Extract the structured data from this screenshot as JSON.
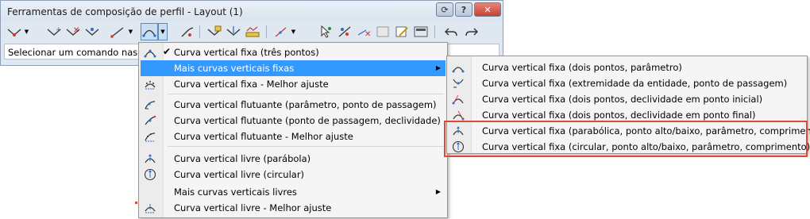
{
  "window": {
    "title": "Ferramentas de composição de perfil - Layout (1)",
    "help_label": "?",
    "close_label": "✕",
    "extra_button_label": "⟳"
  },
  "toolbar": {
    "icons": [
      "pvi-insert-icon",
      "pvi-add-icon",
      "pvi-delete-icon",
      "pvi-move-icon",
      "line-tool-icon",
      "curve-tool-icon",
      "fillet-icon",
      "pvi-table-icon",
      "pvi-raise-icon",
      "pvi-graph-icon",
      "tangent-icon",
      "select-pvi-icon",
      "move-pvi-icon",
      "delete-entity-icon",
      "sub-entity-icon",
      "edit-icon",
      "grid-view-icon",
      "undo-icon",
      "redo-icon"
    ]
  },
  "status": {
    "text": "Selecionar um comando nas fe"
  },
  "menu_main": {
    "items": [
      {
        "label": "Curva vertical fixa (três pontos)",
        "checked": true,
        "icon": "curve-three-points-icon"
      },
      {
        "label": "Mais curvas verticais fixas",
        "highlighted": true,
        "submenu": true
      },
      {
        "label": "Curva vertical fixa - Melhor ajuste",
        "icon": "best-fit-icon"
      },
      {
        "label": "Curva vertical flutuante (parâmetro, ponto de passagem)",
        "icon": "float-param-icon"
      },
      {
        "label": "Curva vertical flutuante (ponto de passagem, declividade)",
        "icon": "float-slope-icon"
      },
      {
        "label": "Curva vertical flutuante - Melhor ajuste",
        "icon": "float-bestfit-icon"
      },
      {
        "label": "Curva vertical livre (parábola)",
        "icon": "free-parabola-icon"
      },
      {
        "label": "Curva vertical livre (circular)",
        "icon": "free-circular-icon"
      },
      {
        "label": "Mais curvas verticais livres",
        "submenu": true
      },
      {
        "label": "Curva vertical livre - Melhor ajuste",
        "icon": "free-bestfit-icon"
      }
    ]
  },
  "menu_sub": {
    "items": [
      {
        "label": "Curva vertical fixa (dois pontos, parâmetro)",
        "icon": "two-points-param-icon"
      },
      {
        "label": "Curva vertical fixa (extremidade da entidade, ponto de passagem)",
        "icon": "entity-end-icon"
      },
      {
        "label": "Curva vertical fixa (dois pontos, declividade em ponto inicial)",
        "icon": "slope-start-icon"
      },
      {
        "label": "Curva vertical fixa (dois pontos, declividade em ponto final)",
        "icon": "slope-end-icon"
      },
      {
        "label": "Curva vertical fixa (parabólica, ponto alto/baixo, parâmetro, comprimento)",
        "icon": "parabolic-highlow-icon"
      },
      {
        "label": "Curva vertical fixa (circular, ponto alto/baixo, parâmetro, comprimento)",
        "icon": "circular-highlow-icon"
      }
    ]
  },
  "colors": {
    "highlight": "#3399ff",
    "callout_border": "#e0463a",
    "close_button": "#c7412f"
  }
}
